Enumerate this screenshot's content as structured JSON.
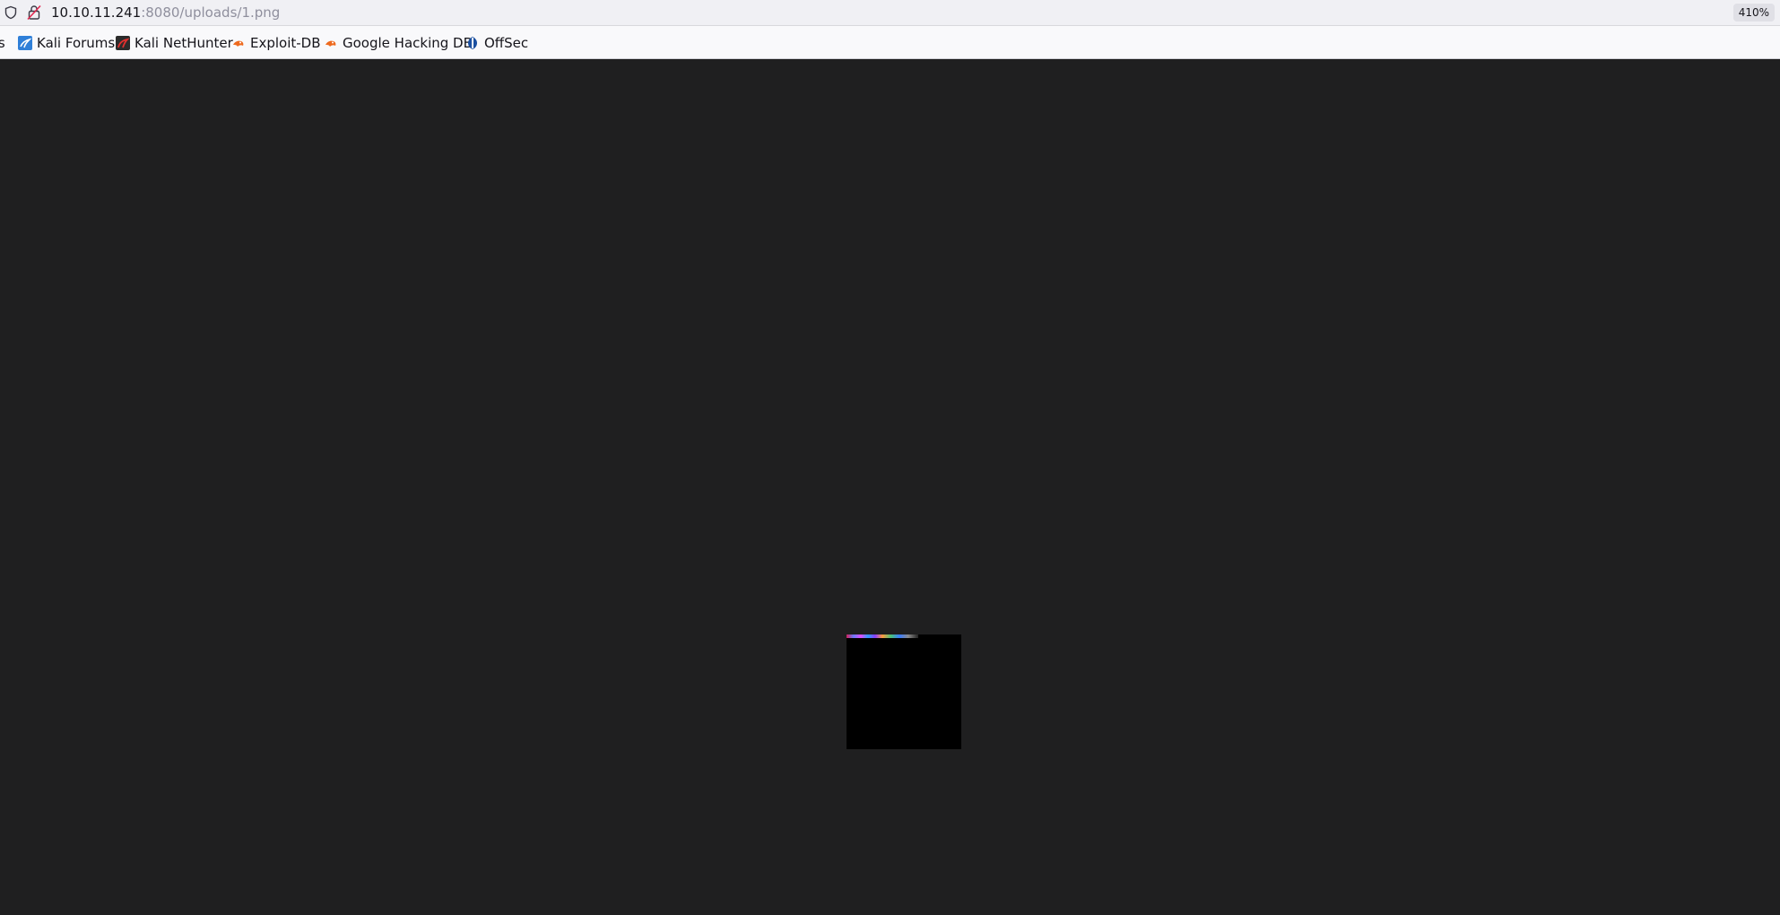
{
  "browser": {
    "url_host": "10.10.11.241",
    "url_rest": ":8080/uploads/1.png",
    "zoom_label": "410%"
  },
  "bookmarks": {
    "items": [
      {
        "label": "ts",
        "icon": "truncated-bookmark"
      },
      {
        "label": "Kali Forums",
        "icon": "kali-dragon-icon"
      },
      {
        "label": "Kali NetHunter",
        "icon": "kali-nethunter-icon"
      },
      {
        "label": "Exploit-DB",
        "icon": "exploit-db-icon"
      },
      {
        "label": "Google Hacking DB",
        "icon": "ghdb-icon"
      },
      {
        "label": "OffSec",
        "icon": "offsec-icon"
      }
    ]
  },
  "viewer": {
    "image_alt": "1.png",
    "background": "#1f1f20",
    "image_color": "#000000"
  }
}
